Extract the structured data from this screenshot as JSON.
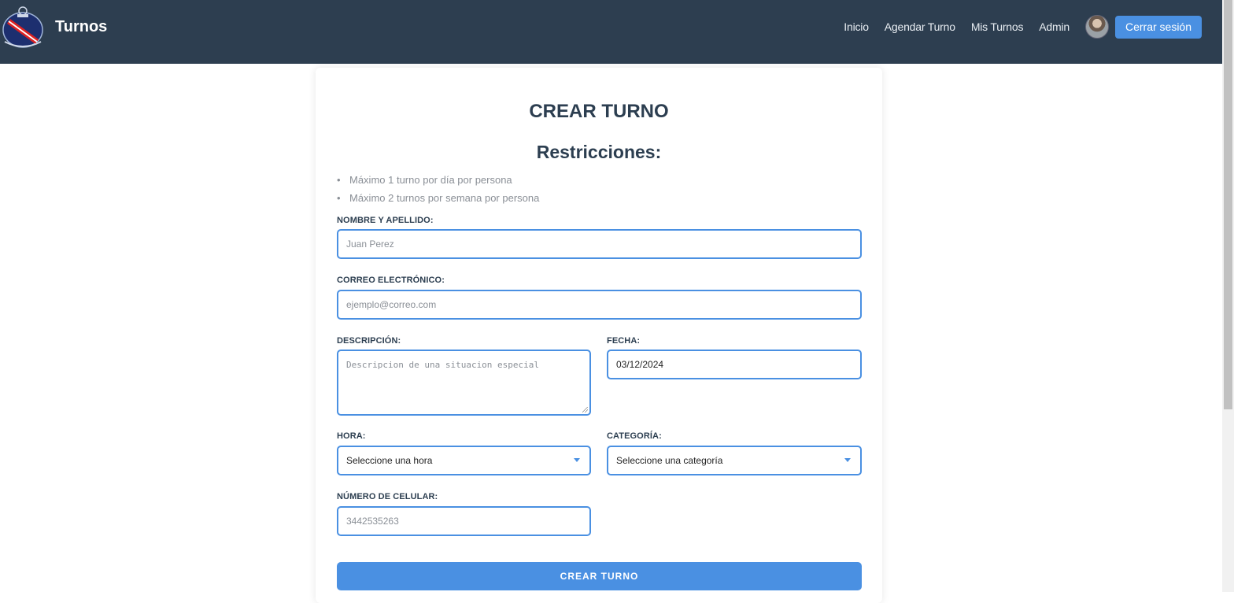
{
  "navbar": {
    "brand": "Turnos",
    "links": [
      "Inicio",
      "Agendar Turno",
      "Mis Turnos",
      "Admin"
    ],
    "logout_label": "Cerrar sesión"
  },
  "form": {
    "title": "CREAR TURNO",
    "restrictions_title": "Restricciones:",
    "restrictions": [
      "Máximo 1 turno por día por persona",
      "Máximo 2 turnos por semana por persona"
    ],
    "name_label": "NOMBRE Y APELLIDO:",
    "name_placeholder": "Juan Perez",
    "email_label": "CORREO ELECTRÓNICO:",
    "email_placeholder": "ejemplo@correo.com",
    "description_label": "DESCRIPCIÓN:",
    "description_placeholder": "Descripcion de una situacion especial",
    "date_label": "FECHA:",
    "date_value": "03/12/2024",
    "time_label": "HORA:",
    "time_selected": "Seleccione una hora",
    "category_label": "CATEGORÍA:",
    "category_selected": "Seleccione una categoría",
    "phone_label": "NÚMERO DE CELULAR:",
    "phone_placeholder": "3442535263",
    "submit_label": "CREAR TURNO"
  },
  "colors": {
    "navbar_bg": "#2d3e50",
    "accent": "#4a90e2",
    "text_dark": "#2c3e50",
    "muted": "#8a8f96"
  }
}
